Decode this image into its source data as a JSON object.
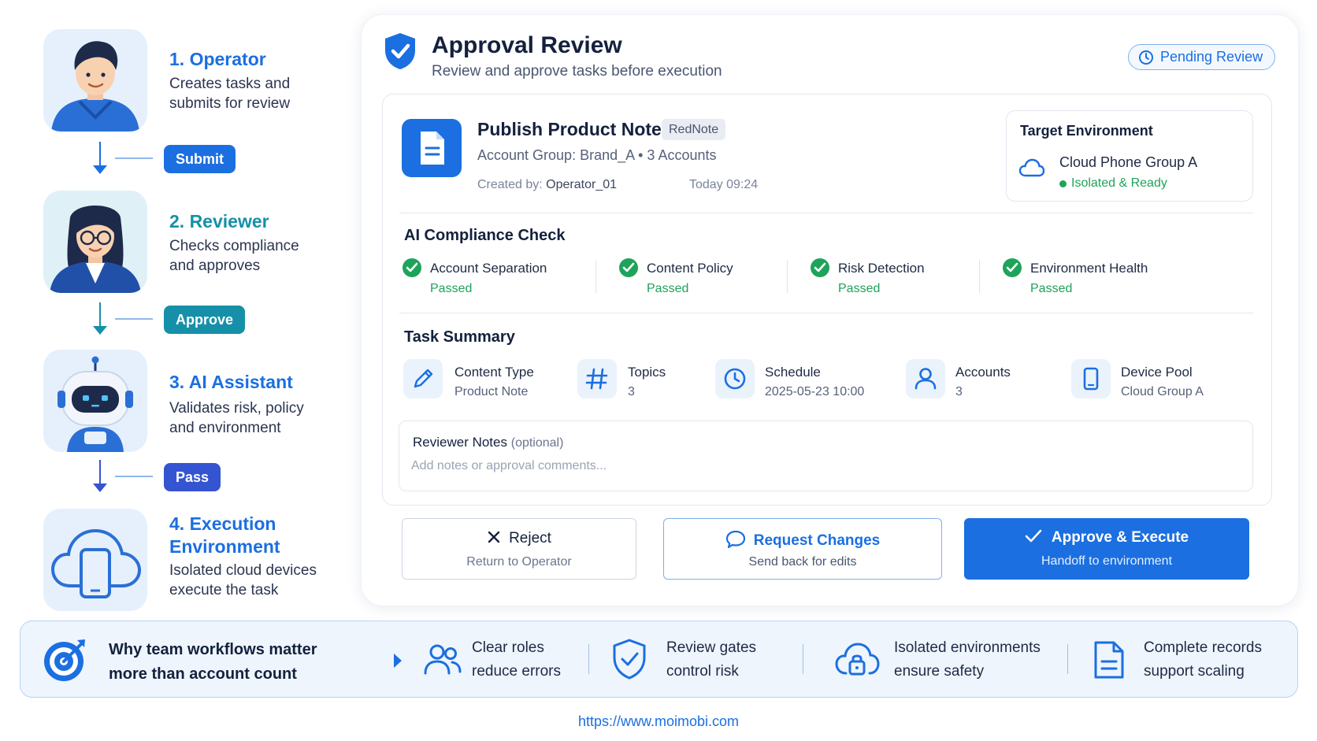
{
  "workflow": {
    "steps": [
      {
        "title": "1. Operator",
        "desc_line1": "Creates tasks and",
        "desc_line2": "submits for review"
      },
      {
        "title": "2. Reviewer",
        "desc_line1": "Checks compliance",
        "desc_line2": "and approves"
      },
      {
        "title": "3. AI Assistant",
        "desc_line1": "Validates risk, policy",
        "desc_line2": "and environment"
      },
      {
        "title_line1": "4. Execution",
        "title_line2": "Environment",
        "desc_line1": "Isolated cloud devices",
        "desc_line2": "execute the task"
      }
    ],
    "transitions": [
      "Submit",
      "Approve",
      "Pass"
    ]
  },
  "review": {
    "title": "Approval Review",
    "subtitle": "Review and approve tasks before execution",
    "status_badge": "Pending Review"
  },
  "task": {
    "title": "Publish Product Note",
    "platform_tag": "RedNote",
    "meta": "Account Group: Brand_A  •  3 Accounts",
    "created_label": "Created by:",
    "created_by": "Operator_01",
    "time": "Today 09:24"
  },
  "target": {
    "heading": "Target Environment",
    "name": "Cloud Phone Group A",
    "status": "Isolated & Ready"
  },
  "compliance": {
    "heading": "AI Compliance Check",
    "checks": [
      {
        "label": "Account Separation",
        "status": "Passed"
      },
      {
        "label": "Content Policy",
        "status": "Passed"
      },
      {
        "label": "Risk Detection",
        "status": "Passed"
      },
      {
        "label": "Environment Health",
        "status": "Passed"
      }
    ]
  },
  "summary": {
    "heading": "Task Summary",
    "items": [
      {
        "label": "Content Type",
        "value": "Product Note",
        "icon": "pencil-icon"
      },
      {
        "label": "Topics",
        "value": "3",
        "icon": "hash-icon"
      },
      {
        "label": "Schedule",
        "value": "2025-05-23 10:00",
        "icon": "clock-icon"
      },
      {
        "label": "Accounts",
        "value": "3",
        "icon": "user-icon"
      },
      {
        "label": "Device Pool",
        "value": "Cloud Group A",
        "icon": "phone-icon"
      }
    ]
  },
  "notes": {
    "label": "Reviewer Notes",
    "optional": "(optional)",
    "placeholder": "Add notes or approval comments..."
  },
  "actions": {
    "reject": {
      "label": "Reject",
      "sub": "Return to Operator"
    },
    "request_changes": {
      "label": "Request Changes",
      "sub": "Send back for edits"
    },
    "approve": {
      "label": "Approve & Execute",
      "sub": "Handoff to environment"
    }
  },
  "banner": {
    "title_line1": "Why team workflows matter",
    "title_line2": "more than account count",
    "points": [
      {
        "line1": "Clear roles",
        "line2": "reduce errors",
        "icon": "people-icon"
      },
      {
        "line1": "Review gates",
        "line2": "control risk",
        "icon": "shield-check-icon"
      },
      {
        "line1": "Isolated environments",
        "line2": "ensure safety",
        "icon": "cloud-lock-icon"
      },
      {
        "line1": "Complete records",
        "line2": "support scaling",
        "icon": "document-icon"
      }
    ]
  },
  "footer": {
    "url": "https://www.moimobi.com"
  },
  "colors": {
    "accent": "#1b6fe0",
    "teal": "#1590a8",
    "success": "#1ea35a",
    "pass_pill": "#3454d1"
  }
}
